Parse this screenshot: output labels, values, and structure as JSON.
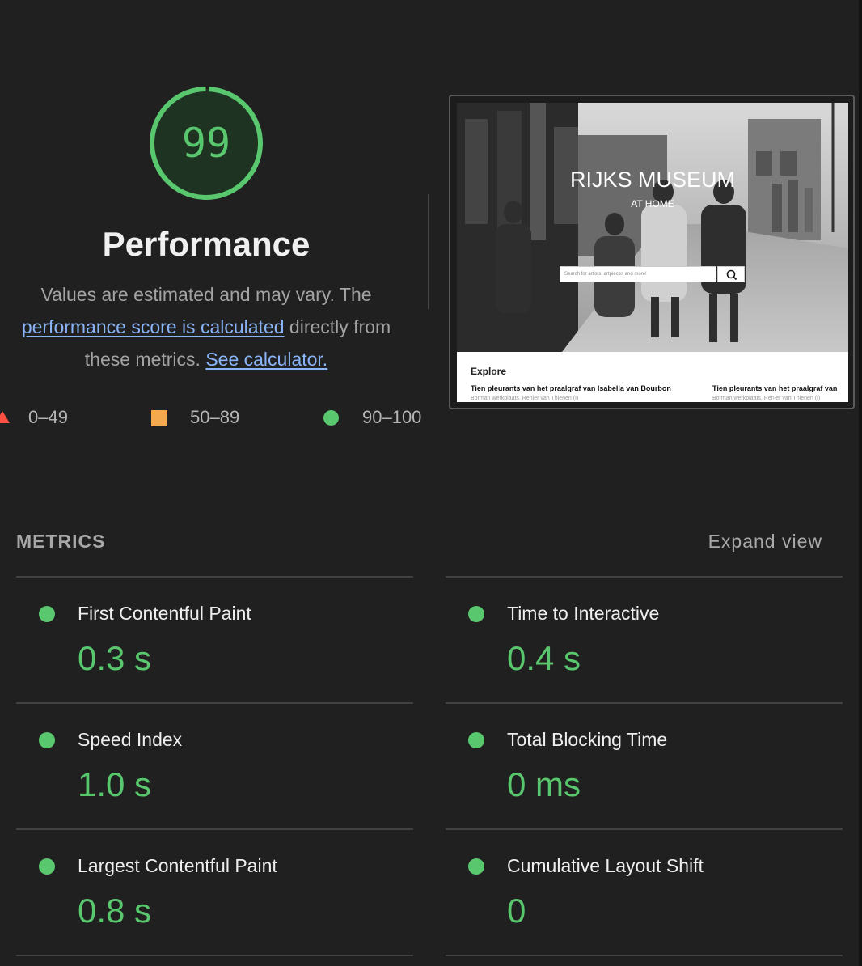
{
  "gauge": {
    "score": "99",
    "score_fraction": 0.99,
    "title": "Performance",
    "color": "#59c76d"
  },
  "description": {
    "text1": "Values are estimated and may vary. The",
    "link1": "performance score is calculated",
    "text2": "directly from",
    "text3": "these metrics.",
    "link2": "See calculator."
  },
  "legend": {
    "fail": "0–49",
    "average": "50–89",
    "pass": "90–100",
    "colors": {
      "fail": "#ff4e42",
      "average": "#f4a94e",
      "pass": "#59c76d"
    }
  },
  "screenshot": {
    "hero_title": "RIJKS MUSEUM",
    "hero_sub": "AT HOME",
    "search_placeholder": "Search for artists, artpieces and more!",
    "explore": "Explore",
    "items": [
      {
        "title": "Tien pleurants van het praalgraf van Isabella van Bourbon",
        "sub": "Borman werkplaats, Renier van Thienen (I)"
      },
      {
        "title": "Tien pleurants van het praalgraf van",
        "sub": "Borman werkplaats, Renier van Thienen (I)"
      }
    ]
  },
  "metrics": {
    "title": "METRICS",
    "expand": "Expand view",
    "items": [
      {
        "label": "First Contentful Paint",
        "value": "0.3 s"
      },
      {
        "label": "Time to Interactive",
        "value": "0.4 s"
      },
      {
        "label": "Speed Index",
        "value": "1.0 s"
      },
      {
        "label": "Total Blocking Time",
        "value": "0 ms"
      },
      {
        "label": "Largest Contentful Paint",
        "value": "0.8 s"
      },
      {
        "label": "Cumulative Layout Shift",
        "value": "0"
      }
    ]
  }
}
